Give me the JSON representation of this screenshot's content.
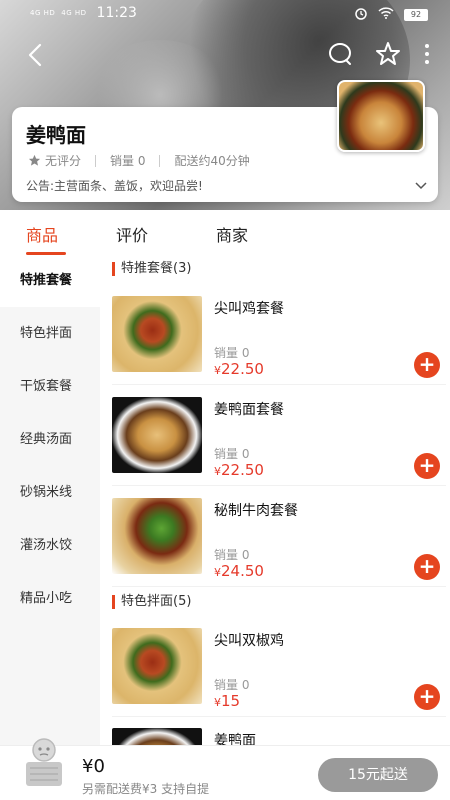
{
  "status": {
    "signal1": "4G HD",
    "signal2": "4G HD",
    "time": "11:23",
    "battery": "92"
  },
  "store": {
    "name": "姜鸭面",
    "rating": "无评分",
    "sales": "销量 0",
    "delivery": "配送约40分钟",
    "notice": "公告:主营面条、盖饭，欢迎品尝!"
  },
  "tabs": [
    "商品",
    "评价",
    "商家"
  ],
  "sidebar": [
    "特推套餐",
    "特色拌面",
    "干饭套餐",
    "经典汤面",
    "砂锅米线",
    "灌汤水饺",
    "精品小吃"
  ],
  "sections": [
    {
      "title": "特推套餐(3)"
    },
    {
      "title": "特色拌面(5)"
    }
  ],
  "items": [
    {
      "name": "尖叫鸡套餐",
      "sales": "销量 0",
      "currency": "¥",
      "price": "22.50"
    },
    {
      "name": "姜鸭面套餐",
      "sales": "销量 0",
      "currency": "¥",
      "price": "22.50"
    },
    {
      "name": "秘制牛肉套餐",
      "sales": "销量 0",
      "currency": "¥",
      "price": "24.50"
    },
    {
      "name": "尖叫双椒鸡",
      "sales": "销量 0",
      "currency": "¥",
      "price": "15"
    },
    {
      "name": "姜鸭面"
    }
  ],
  "bottom": {
    "total": "¥0",
    "fee": "另需配送费¥3  支持自提",
    "checkout": "15元起送"
  },
  "colors": {
    "accent": "#e5451f",
    "price": "#e53a2b",
    "checkout_bg": "#9a9a9a"
  }
}
